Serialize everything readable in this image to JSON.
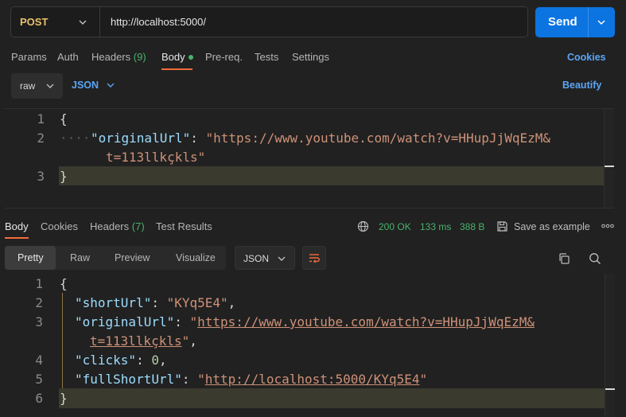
{
  "request": {
    "method": "POST",
    "url": "http://localhost:5000/",
    "send_label": "Send"
  },
  "request_tabs": [
    {
      "label": "Params"
    },
    {
      "label": "Auth"
    },
    {
      "label": "Headers",
      "count": "(9)"
    },
    {
      "label": "Body"
    },
    {
      "label": "Pre-req."
    },
    {
      "label": "Tests"
    },
    {
      "label": "Settings"
    }
  ],
  "cookies_label": "Cookies",
  "body_mode": "raw",
  "body_language": "JSON",
  "beautify_label": "Beautify",
  "request_body": {
    "line_numbers": [
      "1",
      "2",
      "3"
    ],
    "open_brace": "{",
    "key": "\"originalUrl\"",
    "colon": ":",
    "value_part1": "\"https://www.youtube.com/watch?v=HHupJjWqEzM&",
    "value_part2": "t=113llkçkls\"",
    "close_brace": "}"
  },
  "response_tabs": [
    {
      "label": "Body"
    },
    {
      "label": "Cookies"
    },
    {
      "label": "Headers",
      "count": "(7)"
    },
    {
      "label": "Test Results"
    }
  ],
  "response_status": {
    "code": "200 OK",
    "time": "133 ms",
    "size": "388 B",
    "save_label": "Save as example"
  },
  "view_modes": [
    "Pretty",
    "Raw",
    "Preview",
    "Visualize"
  ],
  "response_format": "JSON",
  "response_body": {
    "line_numbers": [
      "1",
      "2",
      "3",
      "4",
      "5",
      "6"
    ],
    "open_brace": "{",
    "k_short": "\"shortUrl\"",
    "v_short": "\"KYq5E4\"",
    "k_original": "\"originalUrl\"",
    "v_original_1": "https://www.youtube.com/watch?v=HHupJjWqEzM&",
    "v_original_2": "t=113llkçkls",
    "k_clicks": "\"clicks\"",
    "v_clicks": "0",
    "k_full": "\"fullShortUrl\"",
    "v_full": "http://localhost:5000/KYq5E4",
    "close_brace": "}"
  },
  "colors": {
    "accent": "#0b74e0",
    "method": "#e8c06b",
    "success": "#48b36b",
    "link": "#5aa6f6",
    "active_underline": "#f36b3b"
  }
}
